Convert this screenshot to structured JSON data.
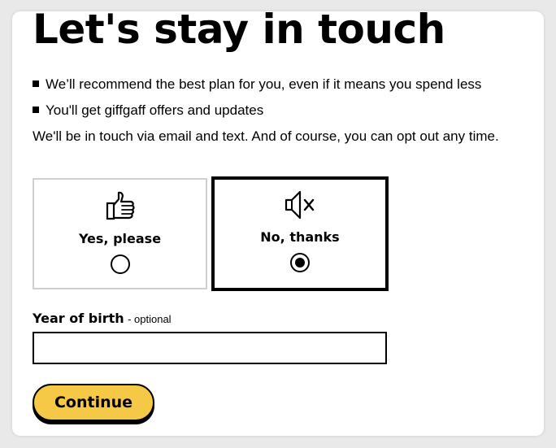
{
  "heading": "Let's stay in touch",
  "bullets": [
    "We’ll recommend the best plan for you, even if it means you spend less",
    "You'll get giffgaff offers and updates"
  ],
  "info_text": "We'll be in touch via email and text. And of course, you can opt out any time.",
  "options": {
    "yes": {
      "label": "Yes, please",
      "icon": "thumbs-up-icon",
      "selected": false
    },
    "no": {
      "label": "No, thanks",
      "icon": "mute-speaker-icon",
      "selected": true
    }
  },
  "year_of_birth": {
    "label": "Year of birth",
    "note": "- optional",
    "value": ""
  },
  "continue_label": "Continue",
  "colors": {
    "accent": "#f5c845",
    "border": "#000000",
    "unselected_border": "#cfcfcf"
  }
}
